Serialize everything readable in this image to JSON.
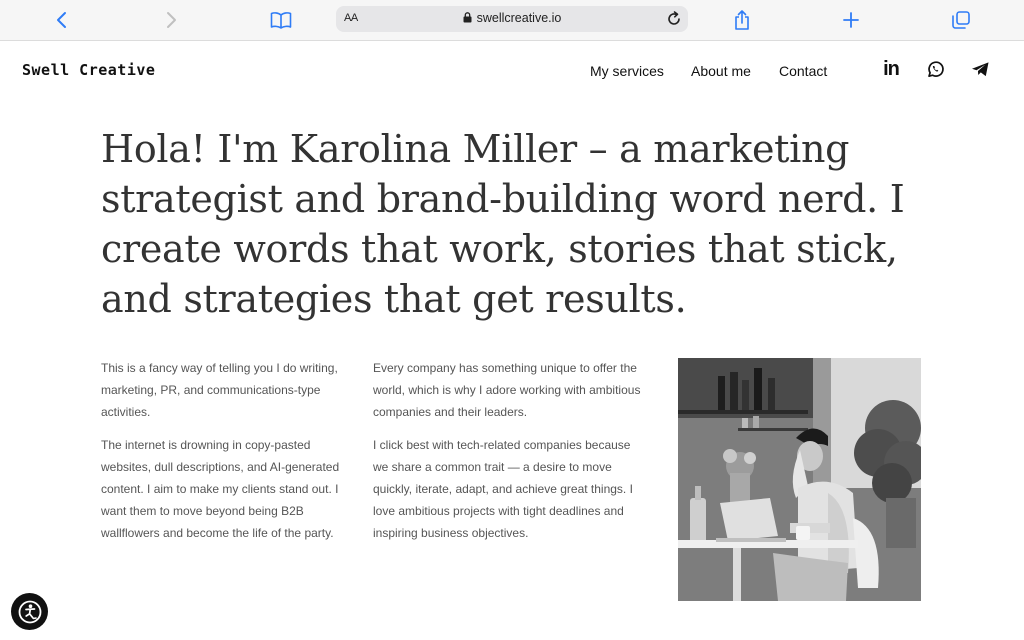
{
  "browser": {
    "text_size_label": "AA",
    "url": "swellcreative.io"
  },
  "site": {
    "logo": "Swell Creative",
    "nav": {
      "services": "My services",
      "about": "About me",
      "contact": "Contact"
    },
    "social": {
      "linkedin": "in"
    }
  },
  "hero": {
    "headline": "Hola! I'm Karolina Miller – a marketing strategist and brand-building word nerd. I create words that work, stories that stick, and strategies that get results."
  },
  "body": {
    "col1": [
      "This is a fancy way of telling you I do writing, marketing, PR, and communications-type activities.",
      "The internet is drowning in copy-pasted websites, dull descriptions, and AI-generated content. I aim to make my clients stand out. I want them to move beyond being B2B wallflowers and become the life of the party."
    ],
    "col2": [
      "Every company has something unique to offer the world, which is why I adore working with ambitious companies and their leaders.",
      "I click best with tech-related companies because we share a common trait — a desire to move quickly, iterate, adapt, and achieve great things. I love ambitious projects with tight deadlines and inspiring business objectives."
    ]
  },
  "icons": {
    "back": "chevron-left-icon",
    "forward": "chevron-right-icon",
    "bookmarks": "book-icon",
    "lock": "lock-icon",
    "reload": "reload-icon",
    "share": "share-icon",
    "new_tab": "plus-icon",
    "tabs": "tabs-icon",
    "linkedin": "linkedin-icon",
    "whatsapp": "whatsapp-icon",
    "telegram": "telegram-icon",
    "accessibility": "accessibility-icon"
  },
  "colors": {
    "browser_accent": "#2f7cf6",
    "text_dark": "#111111",
    "headline": "#333333",
    "body_text": "#555555"
  }
}
